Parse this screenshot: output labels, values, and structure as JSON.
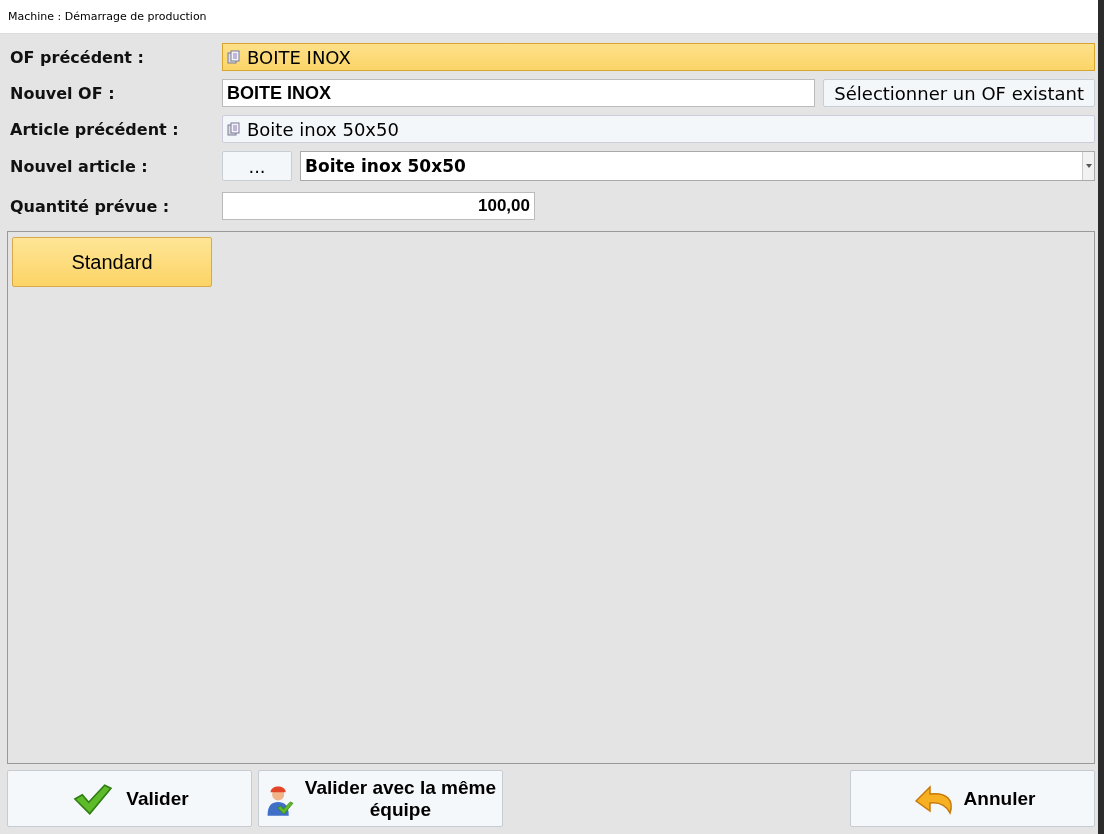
{
  "window": {
    "title": "Machine : Démarrage de production"
  },
  "form": {
    "previous_of": {
      "label": "OF précédent :",
      "value": "BOITE INOX",
      "highlighted": true
    },
    "new_of": {
      "label": "Nouvel OF :",
      "value": "BOITE INOX",
      "button": "Sélectionner un OF existant"
    },
    "previous_article": {
      "label": "Article précédent :",
      "value": "Boite inox  50x50",
      "highlighted": false
    },
    "new_article": {
      "label": "Nouvel article :",
      "button": "...",
      "value": "Boite inox  50x50"
    },
    "planned_quantity": {
      "label": "Quantité prévue :",
      "value": "100,00"
    }
  },
  "categories": [
    {
      "label": "Standard",
      "selected": true
    }
  ],
  "buttons": [
    {
      "kind": "validate",
      "label": "Valider"
    },
    {
      "kind": "team",
      "label": "Valider avec la même équipe"
    },
    {
      "kind": "cancel",
      "label": "Annuler"
    }
  ]
}
